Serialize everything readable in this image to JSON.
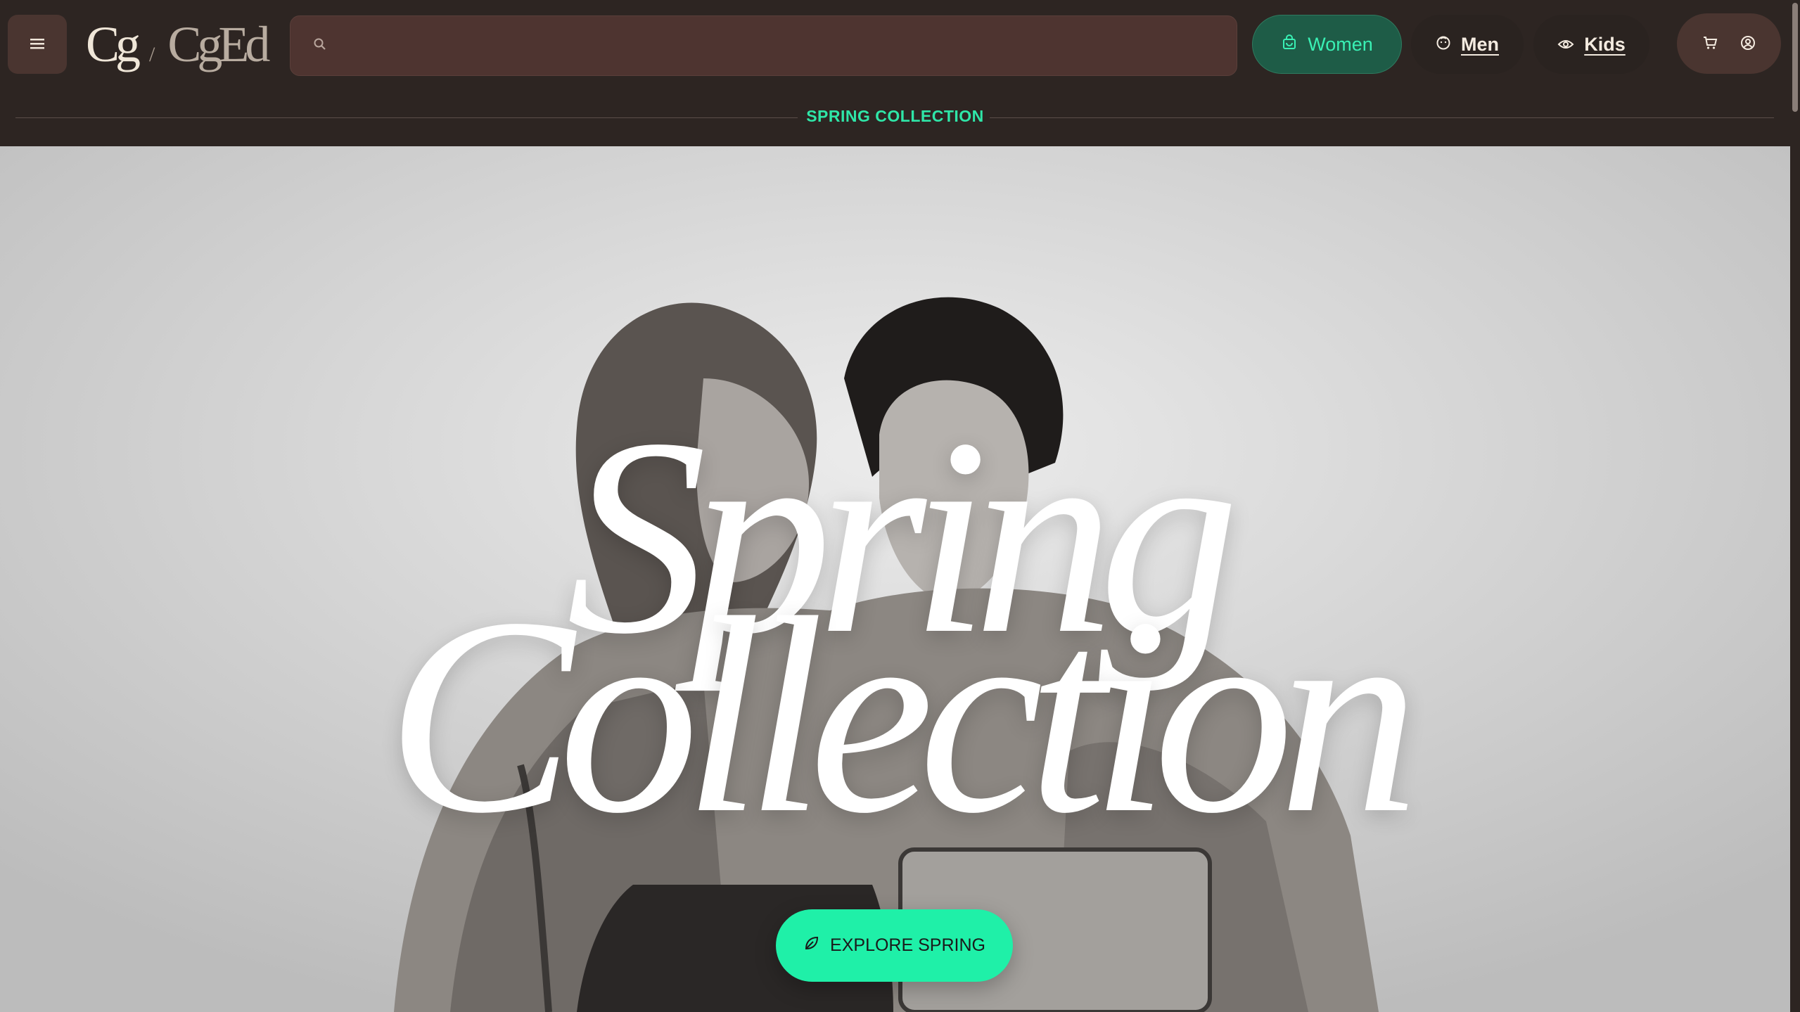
{
  "header": {
    "menu_icon": "hamburger-icon",
    "logo_mark": "Cg",
    "logo_separator": "/",
    "logo_brand": "CgEd",
    "search_placeholder": "",
    "search_icon": "search-icon",
    "nav": [
      {
        "label": "Women",
        "icon": "bag-icon",
        "active": true
      },
      {
        "label": "Men",
        "icon": "face-icon",
        "active": false
      },
      {
        "label": "Kids",
        "icon": "eye-icon",
        "active": false
      }
    ],
    "cart_icon": "cart-icon",
    "account_icon": "user-circle-icon"
  },
  "banner": {
    "text": "SPRING COLLECTION"
  },
  "hero": {
    "title_line1": "Spring",
    "title_line2": "Collection",
    "cta_label": "EXPLORE SPRING",
    "cta_icon": "leaf-icon"
  },
  "colors": {
    "accent": "#1ff0a8",
    "header_bg": "#2d2522",
    "search_bg": "#4e3430",
    "active_nav_bg": "#1e5c47"
  }
}
